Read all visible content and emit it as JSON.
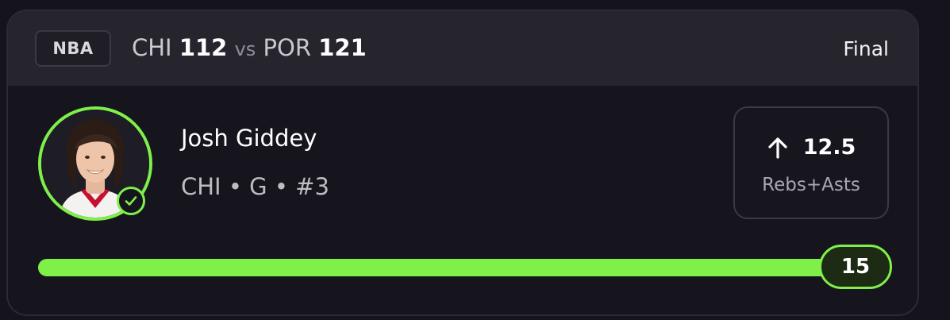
{
  "game": {
    "league": "NBA",
    "away_team": "CHI",
    "away_score": "112",
    "vs": "vs",
    "home_team": "POR",
    "home_score": "121",
    "status": "Final"
  },
  "player": {
    "name": "Josh Giddey",
    "team": "CHI",
    "position": "G",
    "number": "#3",
    "meta": "CHI • G • #3",
    "avatar_icon": "player-headshot",
    "verified_icon": "check-circle-icon"
  },
  "pick": {
    "direction_icon": "arrow-up-icon",
    "line": "12.5",
    "stat": "Rebs+Asts"
  },
  "result": {
    "value": "15",
    "progress": 0.97
  },
  "colors": {
    "accent": "#7ff04a",
    "background": "#15141c",
    "header": "#26252d"
  }
}
